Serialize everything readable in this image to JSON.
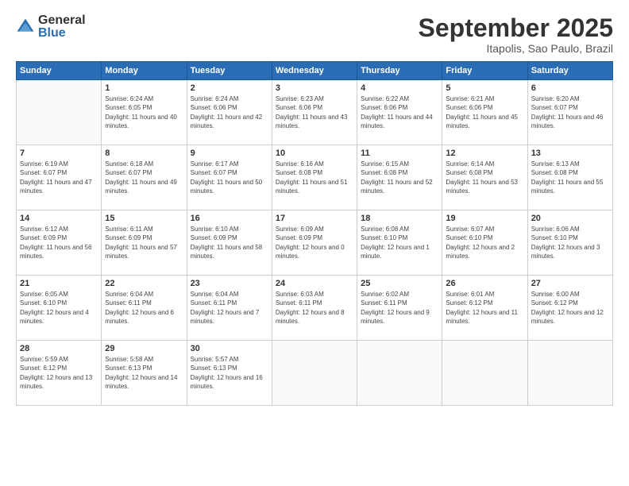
{
  "logo": {
    "general": "General",
    "blue": "Blue"
  },
  "title": "September 2025",
  "subtitle": "Itapolis, Sao Paulo, Brazil",
  "days_header": [
    "Sunday",
    "Monday",
    "Tuesday",
    "Wednesday",
    "Thursday",
    "Friday",
    "Saturday"
  ],
  "weeks": [
    [
      {
        "day": "",
        "sunrise": "",
        "sunset": "",
        "daylight": ""
      },
      {
        "day": "1",
        "sunrise": "Sunrise: 6:24 AM",
        "sunset": "Sunset: 6:05 PM",
        "daylight": "Daylight: 11 hours and 40 minutes."
      },
      {
        "day": "2",
        "sunrise": "Sunrise: 6:24 AM",
        "sunset": "Sunset: 6:06 PM",
        "daylight": "Daylight: 11 hours and 42 minutes."
      },
      {
        "day": "3",
        "sunrise": "Sunrise: 6:23 AM",
        "sunset": "Sunset: 6:06 PM",
        "daylight": "Daylight: 11 hours and 43 minutes."
      },
      {
        "day": "4",
        "sunrise": "Sunrise: 6:22 AM",
        "sunset": "Sunset: 6:06 PM",
        "daylight": "Daylight: 11 hours and 44 minutes."
      },
      {
        "day": "5",
        "sunrise": "Sunrise: 6:21 AM",
        "sunset": "Sunset: 6:06 PM",
        "daylight": "Daylight: 11 hours and 45 minutes."
      },
      {
        "day": "6",
        "sunrise": "Sunrise: 6:20 AM",
        "sunset": "Sunset: 6:07 PM",
        "daylight": "Daylight: 11 hours and 46 minutes."
      }
    ],
    [
      {
        "day": "7",
        "sunrise": "Sunrise: 6:19 AM",
        "sunset": "Sunset: 6:07 PM",
        "daylight": "Daylight: 11 hours and 47 minutes."
      },
      {
        "day": "8",
        "sunrise": "Sunrise: 6:18 AM",
        "sunset": "Sunset: 6:07 PM",
        "daylight": "Daylight: 11 hours and 49 minutes."
      },
      {
        "day": "9",
        "sunrise": "Sunrise: 6:17 AM",
        "sunset": "Sunset: 6:07 PM",
        "daylight": "Daylight: 11 hours and 50 minutes."
      },
      {
        "day": "10",
        "sunrise": "Sunrise: 6:16 AM",
        "sunset": "Sunset: 6:08 PM",
        "daylight": "Daylight: 11 hours and 51 minutes."
      },
      {
        "day": "11",
        "sunrise": "Sunrise: 6:15 AM",
        "sunset": "Sunset: 6:08 PM",
        "daylight": "Daylight: 11 hours and 52 minutes."
      },
      {
        "day": "12",
        "sunrise": "Sunrise: 6:14 AM",
        "sunset": "Sunset: 6:08 PM",
        "daylight": "Daylight: 11 hours and 53 minutes."
      },
      {
        "day": "13",
        "sunrise": "Sunrise: 6:13 AM",
        "sunset": "Sunset: 6:08 PM",
        "daylight": "Daylight: 11 hours and 55 minutes."
      }
    ],
    [
      {
        "day": "14",
        "sunrise": "Sunrise: 6:12 AM",
        "sunset": "Sunset: 6:09 PM",
        "daylight": "Daylight: 11 hours and 56 minutes."
      },
      {
        "day": "15",
        "sunrise": "Sunrise: 6:11 AM",
        "sunset": "Sunset: 6:09 PM",
        "daylight": "Daylight: 11 hours and 57 minutes."
      },
      {
        "day": "16",
        "sunrise": "Sunrise: 6:10 AM",
        "sunset": "Sunset: 6:09 PM",
        "daylight": "Daylight: 11 hours and 58 minutes."
      },
      {
        "day": "17",
        "sunrise": "Sunrise: 6:09 AM",
        "sunset": "Sunset: 6:09 PM",
        "daylight": "Daylight: 12 hours and 0 minutes."
      },
      {
        "day": "18",
        "sunrise": "Sunrise: 6:08 AM",
        "sunset": "Sunset: 6:10 PM",
        "daylight": "Daylight: 12 hours and 1 minute."
      },
      {
        "day": "19",
        "sunrise": "Sunrise: 6:07 AM",
        "sunset": "Sunset: 6:10 PM",
        "daylight": "Daylight: 12 hours and 2 minutes."
      },
      {
        "day": "20",
        "sunrise": "Sunrise: 6:06 AM",
        "sunset": "Sunset: 6:10 PM",
        "daylight": "Daylight: 12 hours and 3 minutes."
      }
    ],
    [
      {
        "day": "21",
        "sunrise": "Sunrise: 6:05 AM",
        "sunset": "Sunset: 6:10 PM",
        "daylight": "Daylight: 12 hours and 4 minutes."
      },
      {
        "day": "22",
        "sunrise": "Sunrise: 6:04 AM",
        "sunset": "Sunset: 6:11 PM",
        "daylight": "Daylight: 12 hours and 6 minutes."
      },
      {
        "day": "23",
        "sunrise": "Sunrise: 6:04 AM",
        "sunset": "Sunset: 6:11 PM",
        "daylight": "Daylight: 12 hours and 7 minutes."
      },
      {
        "day": "24",
        "sunrise": "Sunrise: 6:03 AM",
        "sunset": "Sunset: 6:11 PM",
        "daylight": "Daylight: 12 hours and 8 minutes."
      },
      {
        "day": "25",
        "sunrise": "Sunrise: 6:02 AM",
        "sunset": "Sunset: 6:11 PM",
        "daylight": "Daylight: 12 hours and 9 minutes."
      },
      {
        "day": "26",
        "sunrise": "Sunrise: 6:01 AM",
        "sunset": "Sunset: 6:12 PM",
        "daylight": "Daylight: 12 hours and 11 minutes."
      },
      {
        "day": "27",
        "sunrise": "Sunrise: 6:00 AM",
        "sunset": "Sunset: 6:12 PM",
        "daylight": "Daylight: 12 hours and 12 minutes."
      }
    ],
    [
      {
        "day": "28",
        "sunrise": "Sunrise: 5:59 AM",
        "sunset": "Sunset: 6:12 PM",
        "daylight": "Daylight: 12 hours and 13 minutes."
      },
      {
        "day": "29",
        "sunrise": "Sunrise: 5:58 AM",
        "sunset": "Sunset: 6:13 PM",
        "daylight": "Daylight: 12 hours and 14 minutes."
      },
      {
        "day": "30",
        "sunrise": "Sunrise: 5:57 AM",
        "sunset": "Sunset: 6:13 PM",
        "daylight": "Daylight: 12 hours and 16 minutes."
      },
      {
        "day": "",
        "sunrise": "",
        "sunset": "",
        "daylight": ""
      },
      {
        "day": "",
        "sunrise": "",
        "sunset": "",
        "daylight": ""
      },
      {
        "day": "",
        "sunrise": "",
        "sunset": "",
        "daylight": ""
      },
      {
        "day": "",
        "sunrise": "",
        "sunset": "",
        "daylight": ""
      }
    ]
  ]
}
